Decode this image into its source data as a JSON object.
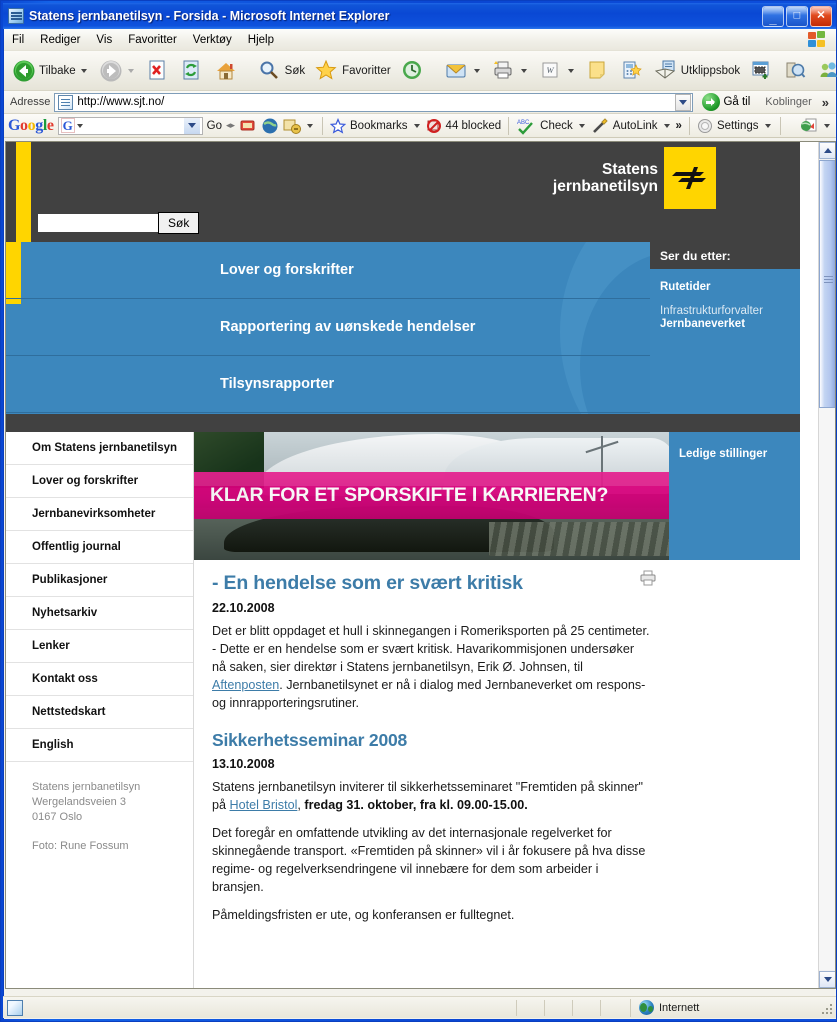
{
  "window": {
    "title": "Statens jernbanetilsyn - Forsida - Microsoft Internet Explorer",
    "minimize": "_",
    "maximize": "□",
    "close": "✕"
  },
  "menubar": {
    "items": [
      "Fil",
      "Rediger",
      "Vis",
      "Favoritter",
      "Verktøy",
      "Hjelp"
    ]
  },
  "toolbar": {
    "back_label": "Tilbake",
    "search_label": "Søk",
    "favorites_label": "Favoritter",
    "clipboard_label": "Utklippsbok"
  },
  "addressbar": {
    "label": "Adresse",
    "url": "http://www.sjt.no/",
    "go_label": "Gå til",
    "links_label": "Koblinger",
    "chevron": "»"
  },
  "googlebar": {
    "logo": [
      "G",
      "o",
      "o",
      "g",
      "l",
      "e"
    ],
    "input_value": "",
    "go_label": "Go",
    "bookmarks_label": "Bookmarks",
    "blocked_label": "44 blocked",
    "check_label": "Check",
    "check_sup": "ABC",
    "autolink_label": "AutoLink",
    "more_chevron": "»",
    "settings_label": "Settings"
  },
  "site": {
    "logo_line1": "Statens",
    "logo_line2": "jernbanetilsyn",
    "search_value": "",
    "search_button": "Søk",
    "mega_nav": [
      "Lover og forskrifter",
      "Rapportering av uønskede hendelser",
      "Tilsynsrapporter"
    ],
    "ser_du_etter": {
      "heading": "Ser du etter:",
      "link1": "Rutetider",
      "sub_line1": "Infrastrukturforvalter",
      "sub_line2": "Jernbaneverket"
    },
    "leftnav": [
      "Om Statens jernbanetilsyn",
      "Lover og forskrifter",
      "Jernbanevirksomheter",
      "Offentlig journal",
      "Publikasjoner",
      "Nyhetsarkiv",
      "Lenker",
      "Kontakt oss",
      "Nettstedskart",
      "English"
    ],
    "footer_addr": {
      "line1": "Statens jernbanetilsyn",
      "line2": "Wergelandsveien 3",
      "line3": "0167 Oslo",
      "photo": "Foto: Rune Fossum"
    },
    "banner_text": "KLAR FOR ET SPORSKIFTE I KARRIEREN?",
    "right_col": {
      "jobs": "Ledige stillinger"
    },
    "articles": [
      {
        "title": "- En hendelse som er svært kritisk",
        "date": "22.10.2008",
        "para1_a": "Det er blitt oppdaget et hull i skinnegangen i Romeriksporten på 25 centimeter. - Dette er en hendelse som er svært kritisk. Havarikommisjonen undersøker nå saken, sier direktør i Statens jernbanetilsyn, Erik Ø. Johnsen, til ",
        "link1": "Aftenposten",
        "para1_b": ". Jernbanetilsynet er nå i dialog med Jernbaneverket om respons- og innrapporteringsrutiner."
      },
      {
        "title": "Sikkerhetsseminar 2008",
        "date": "13.10.2008",
        "para1_a": "Statens jernbanetilsyn inviterer til sikkerhetsseminaret \"Fremtiden på skinner\" på ",
        "link1": "Hotel Bristol",
        "para1_b": ", ",
        "para1_bold": "fredag 31. oktober, fra kl. 09.00-15.00.",
        "para2": "Det foregår en omfattende utvikling av det internasjonale regelverket for skinnegående transport. «Fremtiden på skinner» vil i år fokusere på hva disse regime- og regelverksendringene vil innebære for dem som arbeider i bransjen.",
        "para3": "Påmeldingsfristen er ute, og konferansen er fulltegnet."
      }
    ]
  },
  "statusbar": {
    "message": "",
    "zone": "Internett"
  },
  "colors": {
    "accent_blue": "#3c87bd",
    "heading_blue": "#3d7ca8",
    "yellow": "#FFD500",
    "dark": "#414141",
    "magenta": "#e3007f"
  }
}
